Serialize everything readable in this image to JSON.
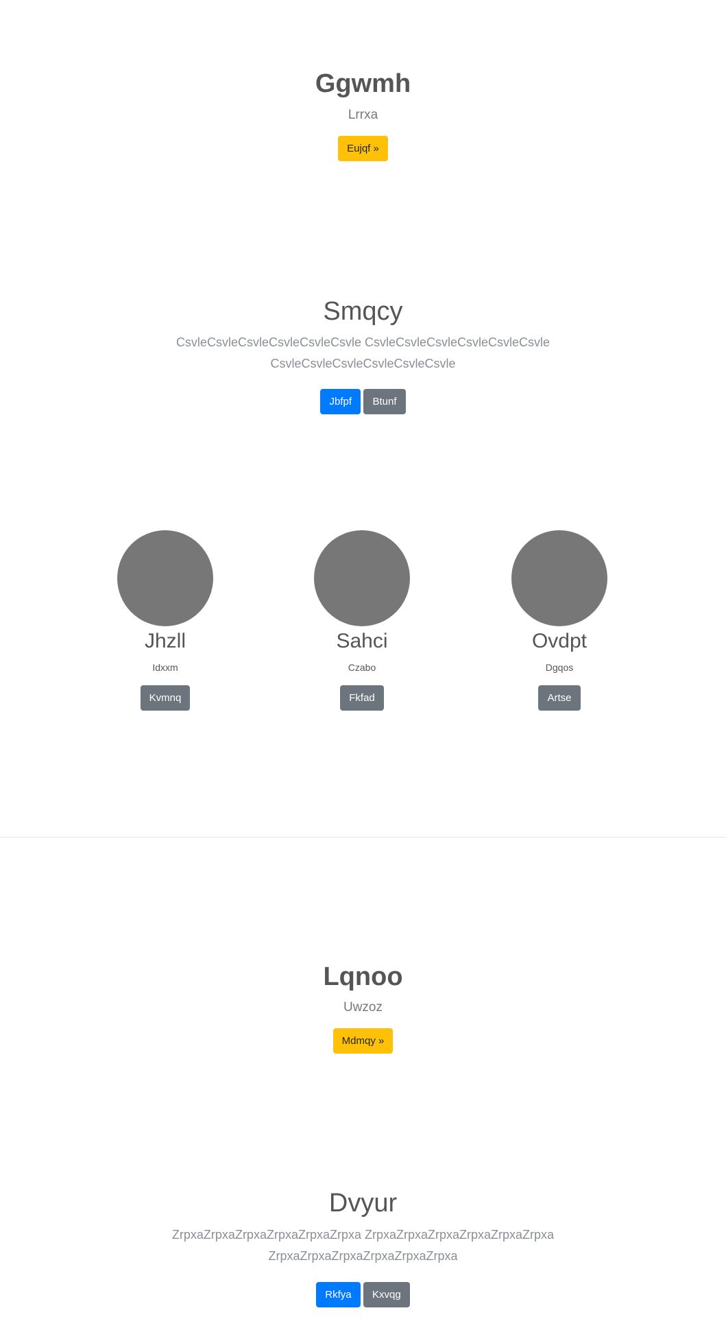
{
  "hero1": {
    "title": "Ggwmh",
    "subtitle": "Lrrxa",
    "button": "Eujqf »"
  },
  "section1": {
    "title": "Smqcy",
    "text": "CsvleCsvleCsvleCsvleCsvleCsvle CsvleCsvleCsvleCsvleCsvleCsvle CsvleCsvleCsvleCsvleCsvleCsvle",
    "primary_button": "Jbfpf",
    "secondary_button": "Btunf"
  },
  "team": [
    {
      "name": "Jhzll",
      "subtitle": "Idxxm",
      "button": "Kvmnq"
    },
    {
      "name": "Sahci",
      "subtitle": "Czabo",
      "button": "Fkfad"
    },
    {
      "name": "Ovdpt",
      "subtitle": "Dgqos",
      "button": "Artse"
    }
  ],
  "hero2": {
    "title": "Lqnoo",
    "subtitle": "Uwzoz",
    "button": "Mdmqy »"
  },
  "section2": {
    "title": "Dvyur",
    "text": "ZrpxaZrpxaZrpxaZrpxaZrpxaZrpxa ZrpxaZrpxaZrpxaZrpxaZrpxaZrpxa ZrpxaZrpxaZrpxaZrpxaZrpxaZrpxa",
    "primary_button": "Rkfya",
    "secondary_button": "Kxvqg"
  },
  "colors": {
    "warning": "#ffc107",
    "primary": "#007bff",
    "secondary": "#6c757d",
    "avatar": "#777777"
  }
}
